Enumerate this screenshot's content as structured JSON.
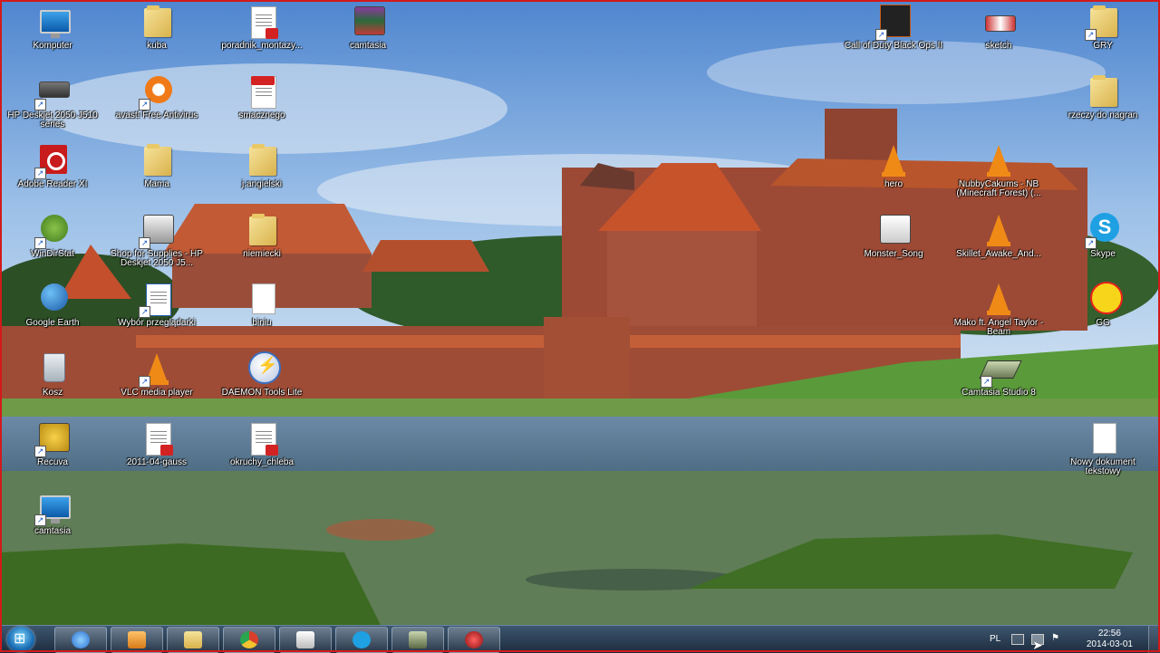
{
  "desktop": {
    "icons": [
      {
        "label": "Komputer",
        "type": "monitor-icon"
      },
      {
        "label": "kuba",
        "type": "folder-icon"
      },
      {
        "label": "poradnik_montazy...",
        "type": "pdf-icon"
      },
      {
        "label": "camtasia",
        "type": "rar-archive-icon"
      },
      {
        "label": "HP Deskjet 2050 J510 series",
        "type": "printer-icon"
      },
      {
        "label": "avast! Free Antivirus",
        "type": "avast-icon"
      },
      {
        "label": "smacznego",
        "type": "pdf-icon"
      },
      {
        "label": "Adobe Reader XI",
        "type": "adobe-reader-icon"
      },
      {
        "label": "Mama",
        "type": "folder-icon"
      },
      {
        "label": "j.angielski",
        "type": "folder-icon"
      },
      {
        "label": "WinDirStat",
        "type": "windirstat-icon"
      },
      {
        "label": "Shop for Supplies - HP Deskjet 2050 J5...",
        "type": "printer-shop-icon"
      },
      {
        "label": "niemiecki",
        "type": "folder-icon"
      },
      {
        "label": "Google Earth",
        "type": "globe-icon"
      },
      {
        "label": "Wybór przeglądarki",
        "type": "browser-choice-icon"
      },
      {
        "label": "biniu",
        "type": "text-file-icon"
      },
      {
        "label": "Kosz",
        "type": "recycle-bin-icon"
      },
      {
        "label": "VLC media player",
        "type": "vlc-icon"
      },
      {
        "label": "DAEMON Tools Lite",
        "type": "daemon-tools-icon"
      },
      {
        "label": "Recuva",
        "type": "recuva-icon"
      },
      {
        "label": "2011-04-gauss",
        "type": "pdf-icon"
      },
      {
        "label": "okruchy_chleba",
        "type": "pdf-icon"
      },
      {
        "label": "camtasia",
        "type": "camtasia-setup-icon"
      },
      {
        "label": "Call of Duty Black Ops II",
        "type": "game-icon"
      },
      {
        "label": "sketch",
        "type": "image-icon"
      },
      {
        "label": "GRY",
        "type": "folder-icon"
      },
      {
        "label": "rzeczy do nagran",
        "type": "folder-icon"
      },
      {
        "label": "hero",
        "type": "vlc-icon"
      },
      {
        "label": "NubbyCakums - NB (Minecraft Forest) (...",
        "type": "vlc-icon"
      },
      {
        "label": "Monster_Song",
        "type": "media-icon"
      },
      {
        "label": "Skillet_Awake_And...",
        "type": "vlc-icon"
      },
      {
        "label": "Skype",
        "type": "skype-icon"
      },
      {
        "label": "Mako ft. Angel Taylor - Beam",
        "type": "vlc-icon"
      },
      {
        "label": "GG",
        "type": "gg-icon"
      },
      {
        "label": "Camtasia Studio 8",
        "type": "camtasia-icon"
      },
      {
        "label": "Nowy dokument tekstowy",
        "type": "text-file-icon"
      }
    ]
  },
  "taskbar": {
    "pinned": [
      {
        "name": "internet-explorer-icon",
        "color": "#3a8fe0"
      },
      {
        "name": "media-player-icon",
        "color": "#f0a030"
      },
      {
        "name": "explorer-icon",
        "color": "#e8c860"
      },
      {
        "name": "chrome-icon",
        "color": "#d9402b"
      },
      {
        "name": "gg-taskbar-icon",
        "color": "#ddd"
      },
      {
        "name": "skype-taskbar-icon",
        "color": "#1fa0e2"
      },
      {
        "name": "camtasia-studio-icon",
        "color": "#8aa06a"
      },
      {
        "name": "camtasia-recorder-icon",
        "color": "#c03030"
      }
    ],
    "tray": {
      "language": "PL",
      "time": "22:56",
      "date": "2014-03-01"
    }
  },
  "colors": {
    "frame": "#d21a1a",
    "taskbar": "#2a3f57"
  }
}
